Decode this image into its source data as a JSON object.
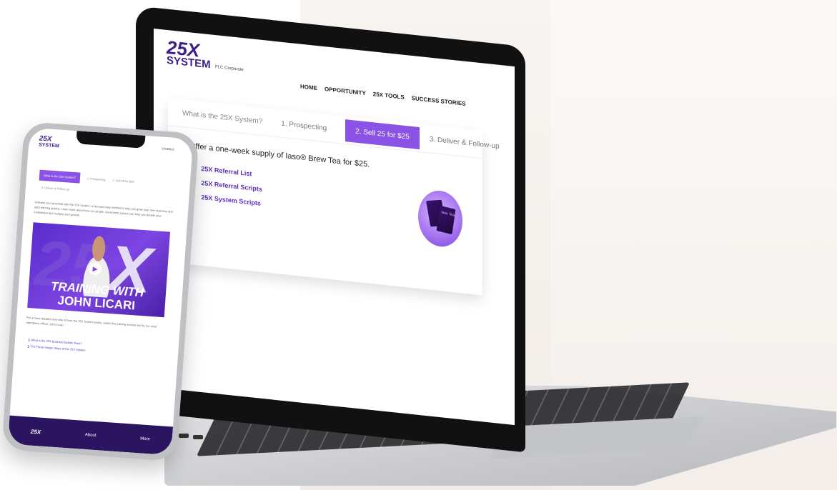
{
  "laptop_site": {
    "logo_big": "25X",
    "logo_small": "SYSTEM",
    "corp": "FLC Corporate",
    "nav": [
      "HOME",
      "OPPORTUNITY",
      "25X TOOLS",
      "SUCCESS STORIES"
    ],
    "tabs": [
      "What is the 25X System?",
      "1. Prospecting",
      "2. Sell 25 for $25",
      "3. Deliver & Follow-up"
    ],
    "offer": "Offer a one-week supply of Iaso® Brew Tea for $25.",
    "links": [
      "25X Referral List",
      "25X Referral Scripts",
      "25X System Scripts"
    ],
    "product_label": "Iaso Tea"
  },
  "phone_site": {
    "logo_big": "25X",
    "logo_small": "SYSTEM",
    "stories": "STORIES",
    "tabs": [
      "What is the 25X System?",
      "1. Prospecting",
      "2. Sell 25 for $25"
    ],
    "subtab": "3. Deliver & Follow-up",
    "intro": "Unleash your potential with the 25X System, a fast and easy method to help you grow your new business and start earning quickly. Learn more about how our simple, convenient system can help you double your investment and multiply your growth.",
    "video": {
      "big_left": "25",
      "big_right": "X",
      "title_line1": "TRAINING WITH",
      "title_line2": "JOHN LICARI"
    },
    "desc": "For a more detailed overview of how the 25X System works, watch this training session led by our chief operations officer, John Licari.",
    "links": [
      "What is the 25X Business Builder Pack?",
      "The Three Simple Steps of the 25X System"
    ],
    "bottom_nav": {
      "mark": "25X",
      "about": "About",
      "more": "More"
    }
  }
}
